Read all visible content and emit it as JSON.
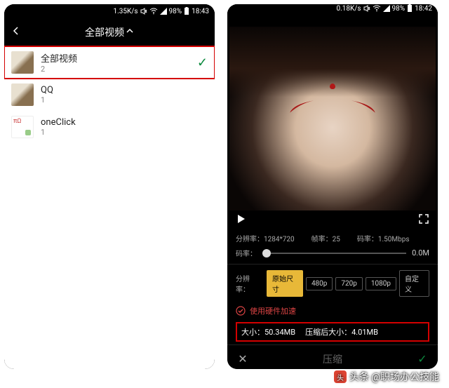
{
  "left": {
    "status": {
      "speed": "1.35K/s",
      "battery": "98%",
      "time": "18:43"
    },
    "header": {
      "title": "全部视频"
    },
    "folders": [
      {
        "name": "全部视频",
        "count": "2",
        "selected": true
      },
      {
        "name": "QQ",
        "count": "1",
        "selected": false
      },
      {
        "name": "oneClick",
        "count": "1",
        "selected": false
      }
    ]
  },
  "right": {
    "status": {
      "speed": "0.18K/s",
      "battery": "98%",
      "time": "18:42"
    },
    "info": {
      "res_label": "分辨率：",
      "res_value": "1284*720",
      "fps_label": "帧率：",
      "fps_value": "25",
      "bitrate_label": "码率：",
      "bitrate_value": "1.50Mbps"
    },
    "slider": {
      "label": "码率：",
      "value": "0.0M"
    },
    "resolution": {
      "label": "分辨率：",
      "options": [
        "原始尺寸",
        "480p",
        "720p",
        "1080p",
        "自定义"
      ],
      "active": 0
    },
    "hw": {
      "label": "使用硬件加速"
    },
    "size": {
      "orig_label": "大小：",
      "orig_value": "50.34MB",
      "comp_label": "压缩后大小：",
      "comp_value": "4.01MB"
    },
    "bottom": {
      "compress": "压缩"
    }
  },
  "watermark": {
    "text": "头条 @职场办公技能"
  }
}
